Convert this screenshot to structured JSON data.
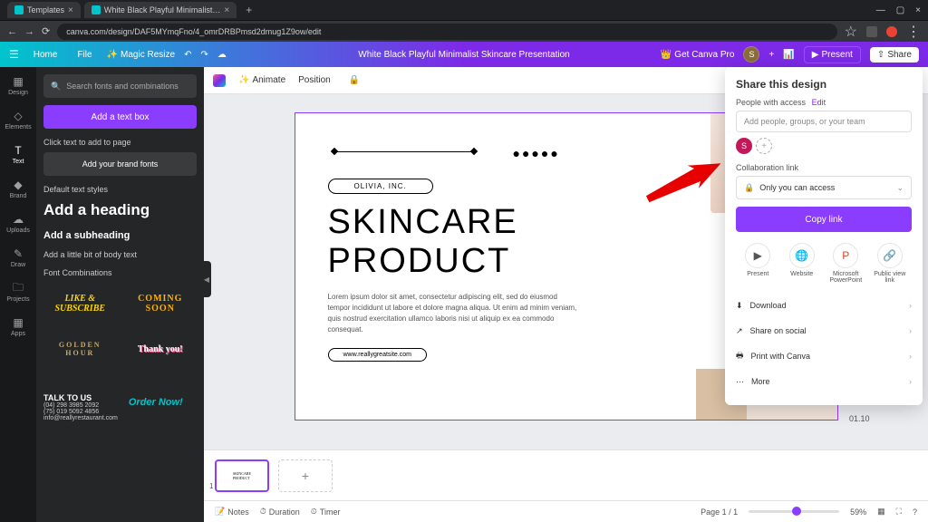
{
  "browser": {
    "tab1": "Templates",
    "tab2": "White Black Playful Minimalist…",
    "url": "canva.com/design/DAF5MYmqFno/4_omrDRBPmsd2dmug1Z9ow/edit"
  },
  "topbar": {
    "home": "Home",
    "file": "File",
    "magic": "Magic Resize",
    "docTitle": "White Black Playful Minimalist Skincare Presentation",
    "pro": "Get Canva Pro",
    "avatar": "S",
    "present": "Present",
    "share": "Share"
  },
  "rail": [
    "Design",
    "Elements",
    "Text",
    "Brand",
    "Uploads",
    "Draw",
    "Projects",
    "Apps"
  ],
  "leftPanel": {
    "searchPlaceholder": "Search fonts and combinations",
    "addText": "Add a text box",
    "clickAdd": "Click text to add to page",
    "brandFonts": "Add your brand fonts",
    "defaultStyles": "Default text styles",
    "heading": "Add a heading",
    "subheading": "Add a subheading",
    "body": "Add a little bit of body text",
    "fontCombos": "Font Combinations",
    "combo1": "LIKE &\nSUBSCRIBE",
    "combo2": "COMING\nSOON",
    "combo3": "GOLDEN\nHOUR",
    "combo4": "Thank\nyou!",
    "talkTitle": "TALK TO US",
    "talkLines": "(04) 298 3985 2092\n(75) 019 5092 4856\ninfo@reallyrestaurant.com",
    "orderNow": "Order Now!"
  },
  "canvasToolbar": {
    "animate": "Animate",
    "position": "Position"
  },
  "page": {
    "brand": "OLIVIA, INC.",
    "headline1": "SKINCARE",
    "headline2": "PRODUCT",
    "body": "Lorem ipsum dolor sit amet, consectetur adipiscing elit, sed do eiusmod tempor incididunt ut labore et dolore magna aliqua. Ut enim ad minim veniam, quis nostrud exercitation ullamco laboris nisi ut aliquip ex ea commodo consequat.",
    "url": "www.reallygreatsite.com",
    "dots": "●●●●●",
    "pageNum": "01.10"
  },
  "share": {
    "title": "Share this design",
    "accessLabel": "People with access",
    "edit": "Edit",
    "addPlaceholder": "Add people, groups, or your team",
    "collabLabel": "Collaboration link",
    "accessSelect": "Only you can access",
    "copy": "Copy link",
    "grid": [
      "Present",
      "Website",
      "Microsoft PowerPoint",
      "Public view link"
    ],
    "rows": [
      "Download",
      "Share on social",
      "Print with Canva",
      "More"
    ],
    "avatar": "S"
  },
  "pageStrip": {
    "num": "1"
  },
  "status": {
    "notes": "Notes",
    "duration": "Duration",
    "timer": "Timer",
    "pages": "Page 1 / 1",
    "zoom": "59%"
  }
}
